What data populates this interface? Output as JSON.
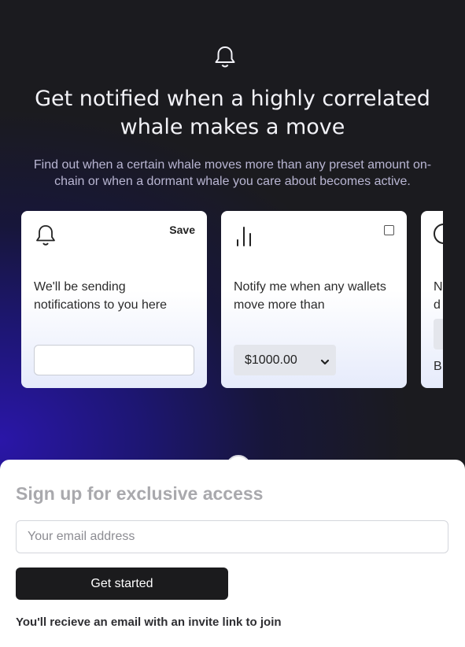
{
  "hero": {
    "title": "Get notified when a highly correlated whale makes a move",
    "subtitle": "Find out when a certain whale moves more than any preset amount on-chain or when a dormant whale you care about becomes active."
  },
  "cards": {
    "notify": {
      "icon": "bell-icon",
      "save_label": "Save",
      "text": "We'll be sending notifications to you here",
      "input_value": ""
    },
    "threshold": {
      "icon": "bar-chart-icon",
      "text": "Notify me when any wallets move more than",
      "selected_amount": "$1000.00",
      "checked": false
    },
    "dormant": {
      "icon": "clock-icon",
      "text_line1": "N",
      "text_line2": "d",
      "foot": "B"
    }
  },
  "signup": {
    "title": "Sign up for exclusive access",
    "email_placeholder": "Your email address",
    "button_label": "Get started",
    "note": "You'll recieve an email with an invite link to join"
  },
  "colors": {
    "background": "#1b1b1f",
    "glow": "#2a16a8",
    "button": "#1b1b1d",
    "muted_title": "#a9a9ad"
  }
}
